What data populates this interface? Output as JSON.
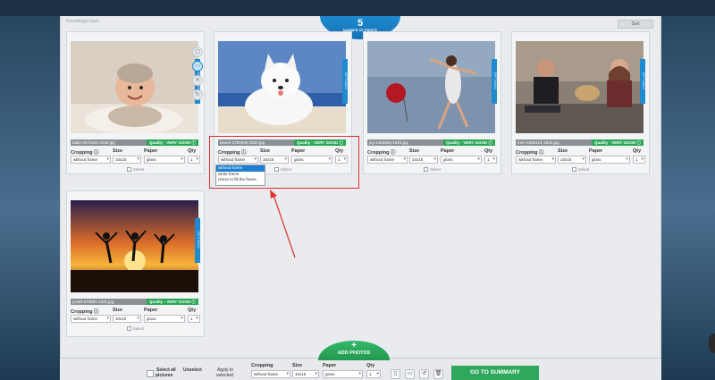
{
  "header": {
    "breadcrumb": "Knowledge base",
    "sort_label": "Sort",
    "prints_count": "5",
    "prints_label": "NUMBER OF PRINTS"
  },
  "photos": [
    {
      "filename": "babe-2972221-1920.jpg",
      "quality_prefix": "Quality - ",
      "quality": "VERY GOOD",
      "cropping": "without frame",
      "size": "10x15",
      "paper": "gloss",
      "qty": "1"
    },
    {
      "filename": "beach-1790049-1920.jpg",
      "quality_prefix": "Quality - ",
      "quality": "VERY GOOD",
      "cropping": "without frame",
      "size": "10x15",
      "paper": "gloss",
      "qty": "1"
    },
    {
      "filename": "joy-2483926-1920.jpg",
      "quality_prefix": "Quality - ",
      "quality": "VERY GOOD",
      "cropping": "without frame",
      "size": "10x15",
      "paper": "gloss",
      "qty": "1"
    },
    {
      "filename": "men-2425121-1920.jpg",
      "quality_prefix": "Quality - ",
      "quality": "VERY GOOD",
      "cropping": "without frame",
      "size": "10x15",
      "paper": "gloss",
      "qty": "1"
    },
    {
      "filename": "youth-570881-1920.jpg",
      "quality_prefix": "Quality - ",
      "quality": "VERY GOOD",
      "cropping": "without frame",
      "size": "10x15",
      "paper": "gloss",
      "qty": "1"
    }
  ],
  "field_labels": {
    "cropping": "Cropping",
    "size": "Size",
    "paper": "Paper",
    "qty": "Qty",
    "select": "Select",
    "options": "OPTIONS"
  },
  "cropping_dropdown": {
    "options": [
      "without frame",
      "white frame",
      "resize to fill the frame"
    ],
    "selected": "without frame"
  },
  "bottom": {
    "add_photos": "ADD PHOTOS",
    "select_all": "Select all",
    "pictures": "pictures",
    "unselect": "Unselect",
    "apply_to": "Apply to",
    "selected": "selected:",
    "cropping": "Cropping",
    "cropping_value": "without frame",
    "size": "Size",
    "size_value": "10x15",
    "paper": "Paper",
    "paper_value": "gloss",
    "qty": "Qty",
    "qty_value": "1",
    "go_to_summary": "GO TO SUMMARY"
  },
  "colors": {
    "accent_blue": "#1e8ad0",
    "quality_green": "#28a653",
    "summary_green": "#2fa85e",
    "highlight_red": "#e03030"
  }
}
